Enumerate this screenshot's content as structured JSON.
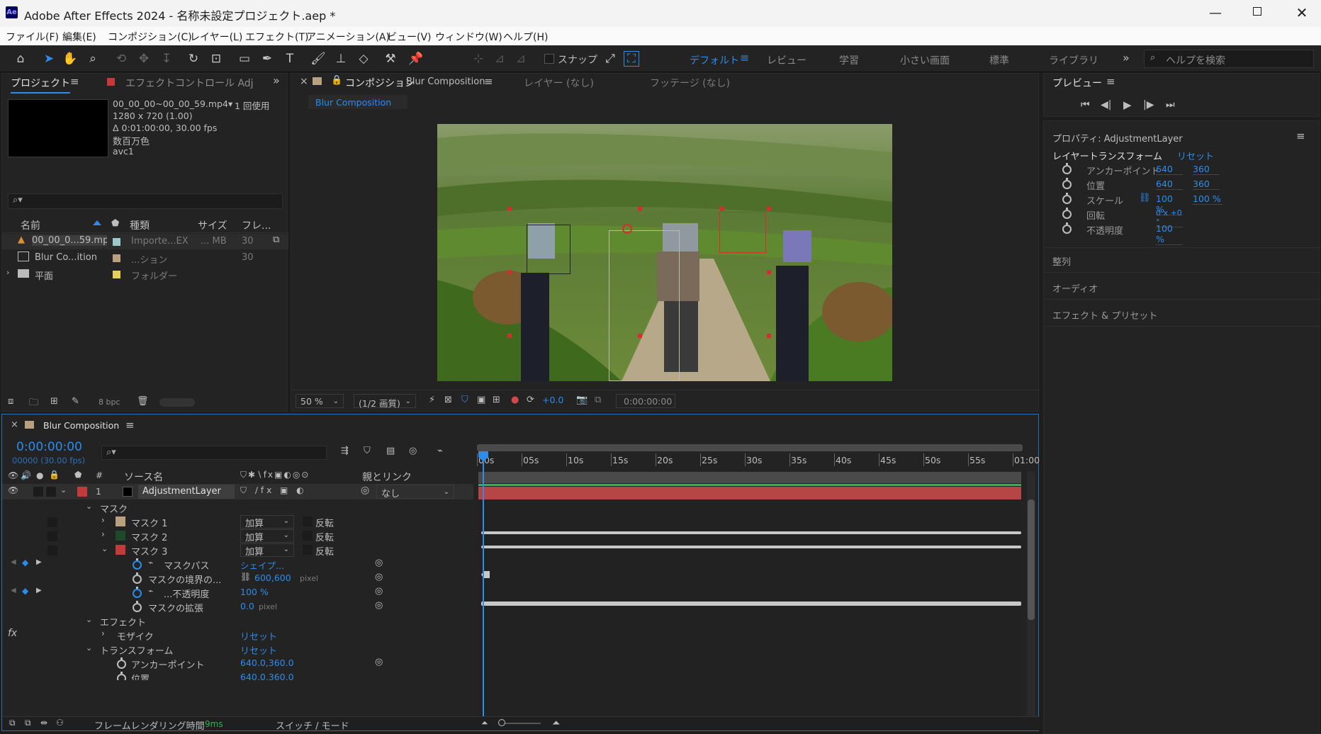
{
  "window": {
    "title": "Adobe After Effects 2024 - 名称未設定プロジェクト.aep *",
    "app_icon": "Ae"
  },
  "menu": [
    "ファイル(F)",
    "編集(E)",
    "コンポジション(C)",
    "レイヤー(L)",
    "エフェクト(T)",
    "アニメーション(A)",
    "ビュー(V)",
    "ウィンドウ(W)",
    "ヘルプ(H)"
  ],
  "toolbar": {
    "snap_label": "スナップ",
    "workspaces": [
      "デフォルト",
      "レビュー",
      "学習",
      "小さい画面",
      "標準",
      "ライブラリ"
    ],
    "help_search_placeholder": "ヘルプを検索"
  },
  "project": {
    "tab_project": "プロジェクト",
    "tab_effects": "エフェクトコントロール Adjustme",
    "thumb_name": "00_00_00~00_00_59.mp4▾",
    "thumb_used": "1 回使用",
    "thumb_res": "1280 x 720 (1.00)",
    "thumb_duration": "Δ 0:01:00:00, 30.00 fps",
    "thumb_color": "数百万色",
    "thumb_codec": "avc1",
    "col_name": "名前",
    "col_type": "種類",
    "col_size": "サイズ",
    "col_frame": "フレ...",
    "items": [
      {
        "name": "00_00_0...59.mp4",
        "type": "Importe...EX",
        "size": "... MB",
        "frame": "30",
        "label_color": "#9fc8cc"
      },
      {
        "name": "Blur Co...ition",
        "type": "...ション",
        "size": "",
        "frame": "30",
        "label_color": "#b9a180"
      },
      {
        "name": "平面",
        "type": "フォルダー",
        "size": "",
        "frame": "",
        "label_color": "#e6d05a"
      }
    ],
    "bpc": "8 bpc"
  },
  "comp": {
    "tab_label": "コンポジション",
    "tab_name": "Blur Composition",
    "tab_layer": "レイヤー (なし)",
    "tab_footage": "フッテージ (なし)",
    "sub_tab": "Blur Composition",
    "zoom": "50 %",
    "quality": "(1/2 画質)",
    "exposure": "+0.0",
    "timecode": "0:00:00:00"
  },
  "preview": {
    "title": "プレビュー"
  },
  "properties": {
    "title": "プロパティ: AdjustmentLayer",
    "section": "レイヤートランスフォーム",
    "reset": "リセット",
    "rows": [
      {
        "label": "アンカーポイント",
        "v1": "640",
        "v2": "360"
      },
      {
        "label": "位置",
        "v1": "640",
        "v2": "360"
      },
      {
        "label": "スケール",
        "v1": "100 %",
        "v2": "100 %"
      },
      {
        "label": "回転",
        "v1": "0 x +0 °",
        "v2": ""
      },
      {
        "label": "不透明度",
        "v1": "100 %",
        "v2": ""
      }
    ],
    "collapsed": [
      "整列",
      "オーディオ",
      "エフェクト & プリセット"
    ]
  },
  "timeline": {
    "tab": "Blur Composition",
    "timecode": "0:00:00:00",
    "frames": "00000 (30.00 fps)",
    "col_source": "ソース名",
    "col_parent": "親とリンク",
    "col_num": "#",
    "ruler": [
      "00s",
      "05s",
      "10s",
      "15s",
      "20s",
      "25s",
      "30s",
      "35s",
      "40s",
      "45s",
      "50s",
      "55s",
      "01:00"
    ],
    "layer": {
      "num": "1",
      "name": "AdjustmentLayer",
      "parent": "なし"
    },
    "rows": {
      "mask_group": "マスク",
      "mask1": "マスク 1",
      "mask2": "マスク 2",
      "mask3": "マスク 3",
      "mode": "加算",
      "invert": "反転",
      "mask_path": "マスクパス",
      "mask_path_val": "シェイプ...",
      "feather": "マスクの境界の...",
      "feather_val": "600,600",
      "feather_unit": "pixel",
      "opacity": "...不透明度",
      "opacity_val": "100 %",
      "expansion": "マスクの拡張",
      "expansion_val": "0.0",
      "expansion_unit": "pixel",
      "effects": "エフェクト",
      "mosaic": "モザイク",
      "reset": "リセット",
      "transform": "トランスフォーム",
      "anchor": "アンカーポイント",
      "anchor_val": "640.0,360.0",
      "position": "位置",
      "position_val": "640.0,360.0"
    },
    "footer_render_label": "フレームレンダリング時間",
    "footer_render_val": "9ms",
    "footer_switch": "スイッチ / モード"
  },
  "colors": {
    "accent": "#2d8ceb",
    "layer_bar": "#b64545",
    "layer_label": "#c23a3a",
    "work_area": "#2bb54a"
  }
}
